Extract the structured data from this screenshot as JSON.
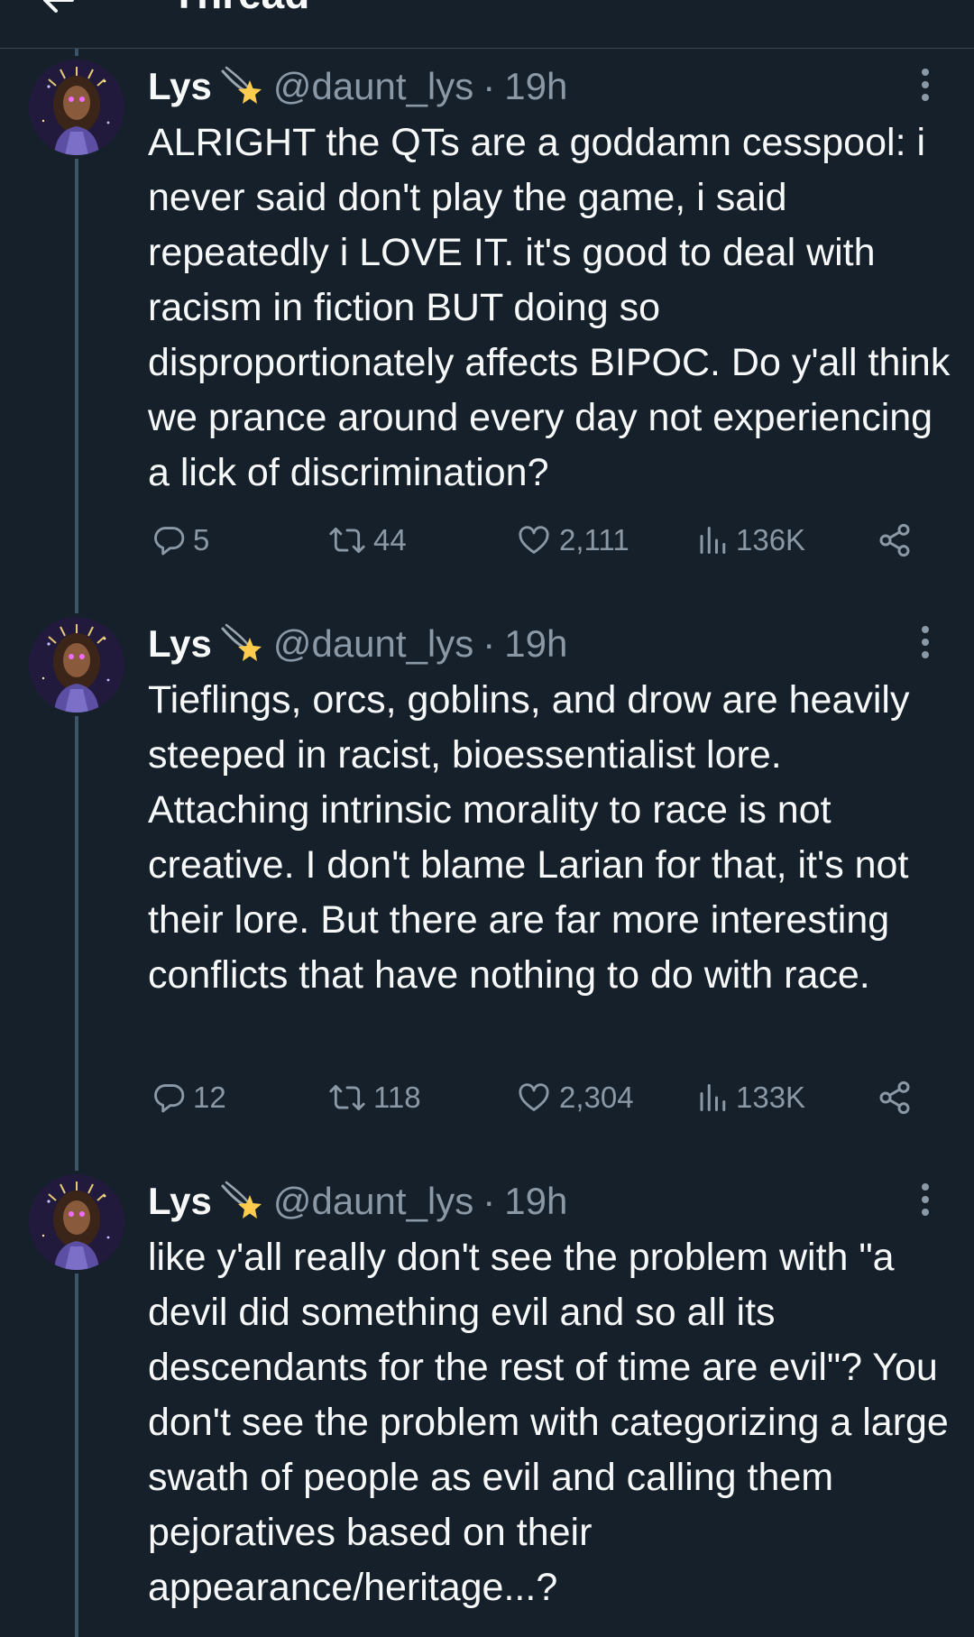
{
  "header": {
    "title": "Thread"
  },
  "tweets": [
    {
      "name": "Lys",
      "badge_icon": "shooting-star-emoji",
      "handle": "@daunt_lys",
      "dot": "·",
      "time": "19h",
      "text": "ALRIGHT the QTs are a goddamn cesspool: i never said don't play the game, i said repeatedly i LOVE IT. it's good to deal with racism in fiction BUT doing so disproportionately affects BIPOC. Do y'all think we prance around every day not experiencing a lick of discrimination?",
      "replies": "5",
      "reposts": "44",
      "likes": "2,111",
      "views": "136K"
    },
    {
      "name": "Lys",
      "badge_icon": "shooting-star-emoji",
      "handle": "@daunt_lys",
      "dot": "·",
      "time": "19h",
      "text": "Tieflings, orcs, goblins, and drow are heavily steeped in racist, bioessentialist lore. Attaching intrinsic morality to race is not creative. I don't blame Larian for that, it's not their lore. But there are far more interesting conflicts that have nothing to do with race.",
      "replies": "12",
      "reposts": "118",
      "likes": "2,304",
      "views": "133K"
    },
    {
      "name": "Lys",
      "badge_icon": "shooting-star-emoji",
      "handle": "@daunt_lys",
      "dot": "·",
      "time": "19h",
      "text": "like y'all really don't see the problem with \"a devil did something evil and so all its descendants for the rest of time are evil\"? You don't see the problem with categorizing a large swath of people as evil and calling them pejoratives based on their appearance/heritage...?"
    }
  ],
  "colors": {
    "background": "#15202b",
    "text": "#f7f9f9",
    "secondary_text": "#8b98a5",
    "thread_line": "#3d5466",
    "divider": "#38444d"
  }
}
